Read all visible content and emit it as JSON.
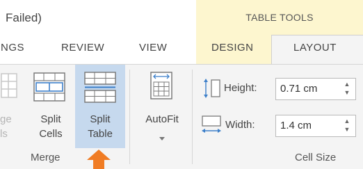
{
  "window": {
    "title_partial": "Failed)"
  },
  "contextual": {
    "group_label": "TABLE TOOLS"
  },
  "tabs": [
    {
      "label": "NGS",
      "partial": true
    },
    {
      "label": "REVIEW"
    },
    {
      "label": "VIEW"
    },
    {
      "label": "DESIGN"
    },
    {
      "label": "LAYOUT",
      "selected": true
    }
  ],
  "merge_group": {
    "merge_cells_partial": {
      "line1": "ge",
      "line2": "ls"
    },
    "split_cells": {
      "line1": "Split",
      "line2": "Cells"
    },
    "split_table": {
      "line1": "Split",
      "line2": "Table",
      "highlighted": true
    },
    "group_label": "Merge"
  },
  "autofit": {
    "label": "AutoFit",
    "dropdown_icon": "chevron-down-icon"
  },
  "cell_size": {
    "height": {
      "label": "Height:",
      "value": "0.71 cm"
    },
    "width": {
      "label": "Width:",
      "value": "1.4 cm"
    },
    "group_label": "Cell Size"
  },
  "colors": {
    "contextual_tab": "#fdf6cf",
    "ribbon_bg": "#f4f4f4",
    "highlight": "#c6d9ee",
    "annotation_arrow": "#f07c24",
    "table_icon_blue": "#3c7fc9"
  }
}
